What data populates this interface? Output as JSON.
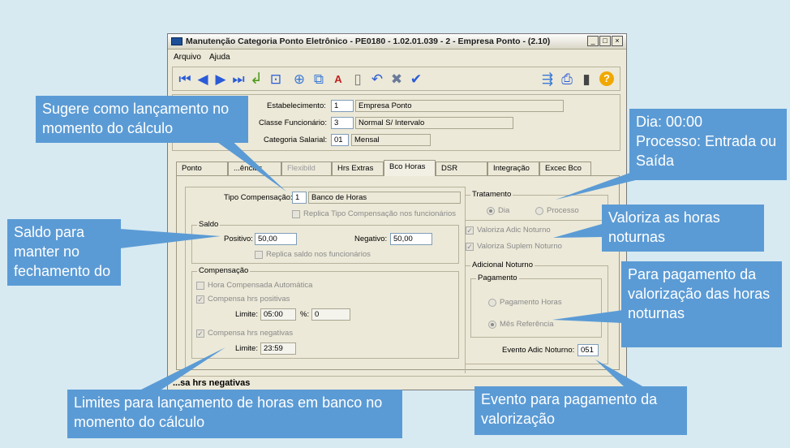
{
  "window": {
    "title": "Manutenção Categoria Ponto Eletrônico - PE0180 - 1.02.01.039 - 2 - Empresa Ponto - (2.10)",
    "controls": {
      "minimize": "_",
      "maximize": "□",
      "close": "×"
    }
  },
  "menu": [
    "Arquivo",
    "Ajuda"
  ],
  "toolbar": {
    "icons": [
      "first-icon",
      "previous-icon",
      "next-icon",
      "last-icon",
      "goto-icon",
      "zoom-icon",
      "new-icon",
      "copy-icon",
      "edit-icon",
      "delete-icon",
      "undo-icon",
      "cancel-icon",
      "confirm-icon",
      "tree-icon",
      "print-icon",
      "exit-icon",
      "help-icon"
    ],
    "help_glyph": "?"
  },
  "header": {
    "estabelecimento_label": "Estabelecimento:",
    "estabelecimento_code": "1",
    "estabelecimento_name": "Empresa Ponto",
    "classe_label": "Classe Funcionário:",
    "classe_code": "3",
    "classe_name": "Normal S/ Intervalo",
    "categoria_label": "Categoria Salarial:",
    "categoria_code": "01",
    "categoria_name": "Mensal"
  },
  "tabs": [
    "Ponto",
    "...ências",
    "Flexibild",
    "Hrs Extras",
    "Bco Horas",
    "DSR",
    "Integração",
    "Excec Bco"
  ],
  "active_tab": "Bco Horas",
  "bco_horas": {
    "tipo_compensacao_label": "Tipo Compensação:",
    "tipo_compensacao_code": "1",
    "tipo_compensacao_name": "Banco de Horas",
    "replica_tipo": "Replica Tipo Compensação nos funcionários",
    "saldo_title": "Saldo",
    "positivo_label": "Positivo:",
    "positivo_value": "50,00",
    "negativo_label": "Negativo:",
    "negativo_value": "50,00",
    "replica_saldo": "Replica saldo nos funcionários",
    "compensacao_title": "Compensação",
    "hora_compensada": "Hora Compensada Automática",
    "compensa_positivas": "Compensa hrs positivas",
    "limite_label": "Limite:",
    "limite_pos": "05:00",
    "pct_label": "%:",
    "pct_value": "0",
    "compensa_negativas": "Compensa hrs negativas",
    "limite_neg": "23:59",
    "tratamento_title": "Tratamento",
    "dia": "Dia",
    "processo": "Processo",
    "valoriza_adic": "Valoriza Adic Noturno",
    "valoriza_suplem": "Valoriza Suplem Noturno",
    "adicional_title": "Adicional Noturno",
    "pagamento_title": "Pagamento",
    "pagamento_horas": "Pagamento Horas",
    "mes_referencia": "Mês Referência",
    "evento_label": "Evento Adic Noturno:",
    "evento_value": "051"
  },
  "status": "...sa hrs negativas",
  "callouts": {
    "sugere": "Sugere como lançamento no momento do cálculo",
    "dia": "Dia: 00:00\nProcesso: Entrada ou Saída",
    "saldo": "Saldo para manter no fechamento do",
    "valoriza": "Valoriza as horas noturnas",
    "para_pagamento": "Para pagamento da valorização das horas noturnas",
    "limites": "Limites para lançamento de horas em banco no momento do cálculo",
    "evento": "Evento para pagamento da valorização"
  },
  "colors": {
    "callout": "#5b9bd5",
    "background": "#d7eaf2",
    "window": "#ece9d8"
  }
}
